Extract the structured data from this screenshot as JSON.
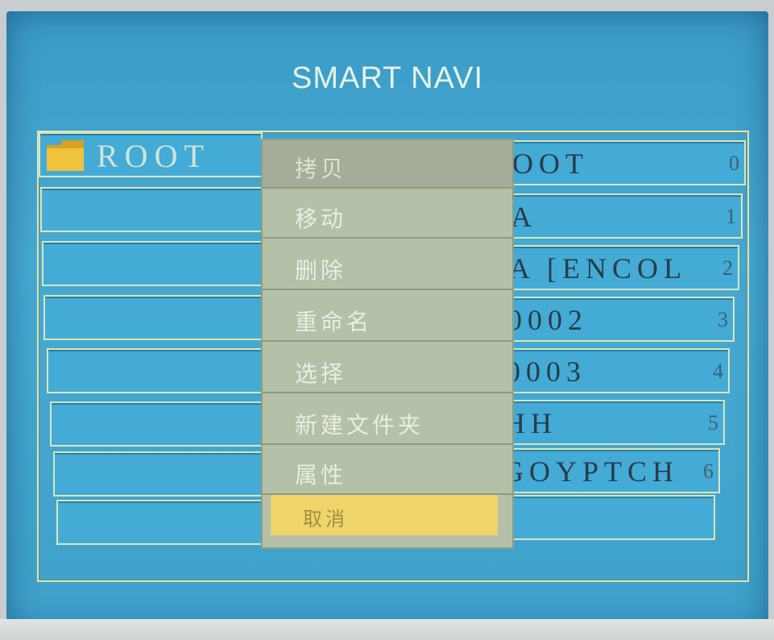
{
  "title": "SMART NAVI",
  "root": {
    "label": "ROOT",
    "icon": "folder-icon"
  },
  "files": [
    {
      "name": "OOT",
      "num": "0"
    },
    {
      "name": "A",
      "num": "1"
    },
    {
      "name": "A [ENCOL",
      "num": "2"
    },
    {
      "name": "0002",
      "num": "3"
    },
    {
      "name": "0003",
      "num": "4"
    },
    {
      "name": "HH",
      "num": "5"
    },
    {
      "name": "GOYPTCH",
      "num": "6"
    },
    {
      "name": "",
      "num": ""
    }
  ],
  "menu": {
    "items": [
      "拷贝",
      "移动",
      "删除",
      "重命名",
      "选择",
      "新建文件夹",
      "属性",
      "取消"
    ],
    "selected_index": 7
  },
  "colors": {
    "screen": "#43abd6",
    "menu": "#b4c0a8",
    "highlight": "#efd46a",
    "folder": "#e6b52c"
  }
}
